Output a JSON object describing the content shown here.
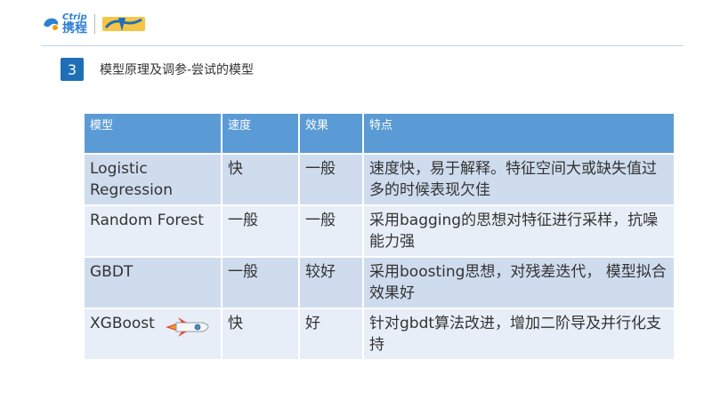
{
  "header": {
    "brand_en": "Ctrip",
    "brand_cn": "携程"
  },
  "slide": {
    "number": "3",
    "title": "模型原理及调参-尝试的模型"
  },
  "table": {
    "columns": [
      "模型",
      "速度",
      "效果",
      "特点"
    ],
    "rows": [
      {
        "model": "Logistic Regression",
        "speed": "快",
        "effect": "一般",
        "feature": "速度快，易于解释。特征空间大或缺失值过多的时候表现欠佳"
      },
      {
        "model": "Random Forest",
        "speed": "一般",
        "effect": "一般",
        "feature": "采用bagging的思想对特征进行采样，抗噪能力强"
      },
      {
        "model": "GBDT",
        "speed": "一般",
        "effect": "较好",
        "feature": "采用boosting思想，对残差迭代， 模型拟合效果好"
      },
      {
        "model": "XGBoost",
        "speed": "快",
        "effect": "好",
        "feature": "针对gbdt算法改进，增加二阶导及并行化支持"
      }
    ]
  },
  "colors": {
    "header_bg": "#5b9bd5",
    "row_odd": "#cfdcee",
    "row_even": "#e8eef7",
    "badge": "#1f6fb8"
  },
  "icons": {
    "rocket": "rocket-icon",
    "brand": "ctrip-logo-icon"
  }
}
